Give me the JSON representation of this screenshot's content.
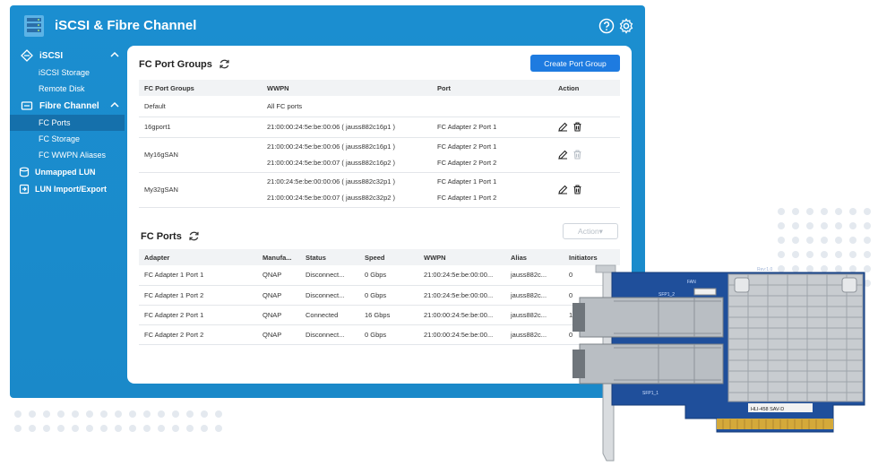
{
  "app": {
    "title": "iSCSI & Fibre Channel"
  },
  "sidebar": {
    "iscsi": {
      "label": "iSCSI",
      "items": [
        "iSCSI Storage",
        "Remote Disk"
      ]
    },
    "fibre": {
      "label": "Fibre Channel",
      "items": [
        "FC Ports",
        "FC Storage",
        "FC WWPN Aliases"
      ],
      "active": "FC Ports"
    },
    "unmapped": "Unmapped LUN",
    "import": "LUN Import/Export"
  },
  "port_groups": {
    "title": "FC Port Groups",
    "create_label": "Create Port Group",
    "columns": [
      "FC Port Groups",
      "WWPN",
      "Port",
      "Action"
    ],
    "rows": [
      {
        "name": "Default",
        "wwpn": [
          "All FC ports"
        ],
        "port": [
          ""
        ]
      },
      {
        "name": "16gport1",
        "wwpn": [
          "21:00:00:24:5e:be:00:06 ( jauss882c16p1 )"
        ],
        "port": [
          "FC Adapter 2 Port 1"
        ]
      },
      {
        "name": "My16gSAN",
        "wwpn": [
          "21:00:00:24:5e:be:00:06 ( jauss882c16p1 )",
          "21:00:00:24:5e:be:00:07 ( jauss882c16p2 )"
        ],
        "port": [
          "FC Adapter 2 Port 1",
          "FC Adapter 2 Port 2"
        ]
      },
      {
        "name": "My32gSAN",
        "wwpn": [
          "21:00:24:5e:be:00:00:06 ( jauss882c32p1 )",
          "21:00:00:24:5e:be:00:07 ( jauss882c32p2 )"
        ],
        "port": [
          "FC Adapter 1 Port 1",
          "FC Adapter 1 Port 2"
        ]
      }
    ]
  },
  "ports": {
    "title": "FC Ports",
    "action_label": "Action▾",
    "columns": [
      "Adapter",
      "Manufa...",
      "Status",
      "Speed",
      "WWPN",
      "Alias",
      "Initiators"
    ],
    "rows": [
      [
        "FC Adapter 1 Port 1",
        "QNAP",
        "Disconnect...",
        "0 Gbps",
        "21:00:24:5e:be:00:00...",
        "jauss882c...",
        "0"
      ],
      [
        "FC Adapter 1 Port 2",
        "QNAP",
        "Disconnect...",
        "0 Gbps",
        "21:00:24:5e:be:00:00...",
        "jauss882c...",
        "0"
      ],
      [
        "FC Adapter 2 Port 1",
        "QNAP",
        "Connected",
        "16 Gbps",
        "21:00:00:24:5e:be:00...",
        "jauss882c...",
        "1"
      ],
      [
        "FC Adapter 2 Port 2",
        "QNAP",
        "Disconnect...",
        "0 Gbps",
        "21:00:00:24:5e:be:00...",
        "jauss882c...",
        "0"
      ]
    ]
  },
  "card": {
    "labels": [
      "Rev:1.0",
      "SFP1_1",
      "SFP1_2",
      "FAN",
      "HLI-458 SAV-D"
    ]
  },
  "colors": {
    "window": "#1a8fd0",
    "active_nav": "#1570ab",
    "primary_button": "#1e7be0",
    "pcb": "#1f4f9b"
  }
}
